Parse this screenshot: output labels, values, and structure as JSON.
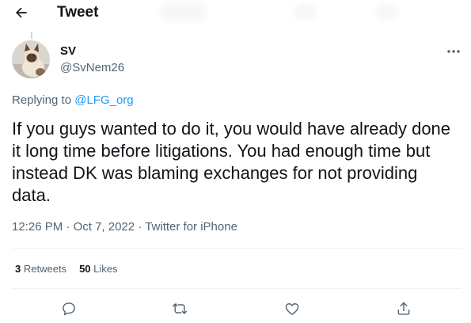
{
  "header": {
    "back_icon": "arrow-left-icon",
    "title": "Tweet"
  },
  "author": {
    "name": "SV",
    "handle": "@SvNem26",
    "avatar": "cat-avatar"
  },
  "reply_context": {
    "prefix": "Replying to",
    "handle": "@LFG_org"
  },
  "tweet": {
    "text": "If you guys wanted to do it, you would have already done it long time before litigations. You had enough time but instead DK was blaming exchanges for not providing data.",
    "time": "12:26 PM",
    "date": "Oct 7, 2022",
    "source": "Twitter for iPhone",
    "separator": " · "
  },
  "stats": {
    "retweets_count": "3",
    "retweets_label": "Retweets",
    "likes_count": "50",
    "likes_label": "Likes"
  },
  "actions": [
    "reply-icon",
    "retweet-icon",
    "like-icon",
    "share-icon"
  ],
  "colors": {
    "accent": "#1d9bf0",
    "text": "#0f1419",
    "secondary": "#536471",
    "divider": "#eff3f4"
  }
}
